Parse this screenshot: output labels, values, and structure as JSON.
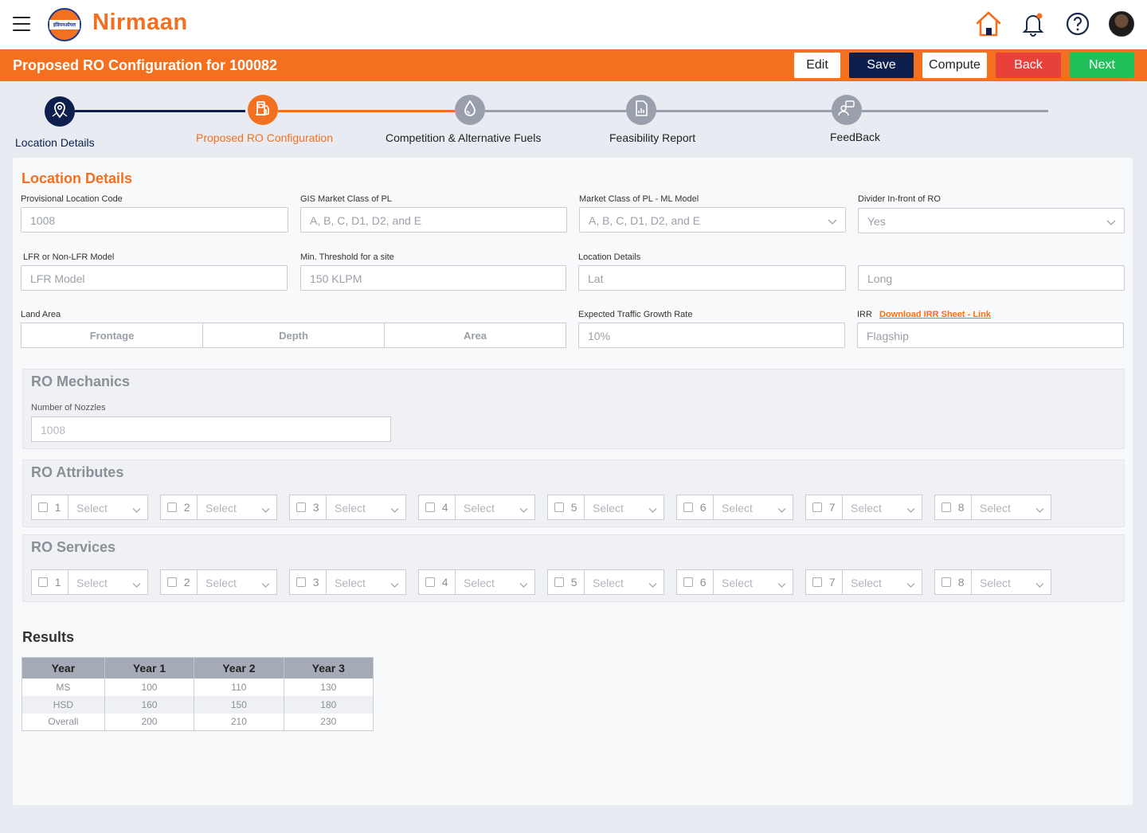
{
  "header": {
    "brand": "Nirmaan",
    "logo_text": "इंडियनऑयल",
    "icons": [
      "menu-icon",
      "home-icon",
      "bell-icon",
      "help-icon",
      "avatar"
    ]
  },
  "titlebar": {
    "title": "Proposed RO Configuration for 100082",
    "buttons": {
      "edit": "Edit",
      "save": "Save",
      "compute": "Compute",
      "back": "Back",
      "next": "Next"
    }
  },
  "stepper": {
    "steps": [
      {
        "label": "Location Details",
        "icon": "map-pin-icon",
        "state": "done"
      },
      {
        "label": "Proposed RO Configuration",
        "icon": "fuel-pump-icon",
        "state": "active"
      },
      {
        "label": "Competition & Alternative Fuels",
        "icon": "drop-icon",
        "state": "pending"
      },
      {
        "label": "Feasibility Report",
        "icon": "report-icon",
        "state": "pending"
      },
      {
        "label": "FeedBack",
        "icon": "feedback-icon",
        "state": "pending"
      }
    ]
  },
  "location": {
    "title": "Location Details",
    "provisional_code": {
      "label": "Provisional Location Code",
      "value": "1008"
    },
    "gis_market": {
      "label": "GIS Market Class of PL",
      "value": "A, B, C, D1, D2, and E"
    },
    "ml_market": {
      "label": "Market Class of PL - ML Model",
      "value": "A, B, C, D1, D2, and E"
    },
    "divider": {
      "label": "Divider In-front of RO",
      "value": "Yes"
    },
    "lfr_model": {
      "label": "LFR or Non-LFR Model",
      "value": "LFR Model"
    },
    "min_threshold": {
      "label": "Min. Threshold for a site",
      "value": "150 KLPM"
    },
    "location_details": {
      "label": "Location Details",
      "lat": "Lat",
      "long": "Long"
    },
    "land_area": {
      "label": "Land Area",
      "frontage": "Frontage",
      "depth": "Depth",
      "area": "Area"
    },
    "traffic_growth": {
      "label": "Expected Traffic Growth Rate",
      "value": "10%"
    },
    "irr": {
      "label": "IRR",
      "link": "Download IRR Sheet - Link",
      "value": "Flagship"
    }
  },
  "mechanics": {
    "title": "RO Mechanics",
    "nozzles": {
      "label": "Number of Nozzles",
      "value": "1008"
    }
  },
  "attributes": {
    "title": "RO Attributes",
    "items": [
      {
        "num": "1",
        "select": "Select"
      },
      {
        "num": "2",
        "select": "Select"
      },
      {
        "num": "3",
        "select": "Select"
      },
      {
        "num": "4",
        "select": "Select"
      },
      {
        "num": "5",
        "select": "Select"
      },
      {
        "num": "6",
        "select": "Select"
      },
      {
        "num": "7",
        "select": "Select"
      },
      {
        "num": "8",
        "select": "Select"
      }
    ]
  },
  "services": {
    "title": "RO Services",
    "items": [
      {
        "num": "1",
        "select": "Select"
      },
      {
        "num": "2",
        "select": "Select"
      },
      {
        "num": "3",
        "select": "Select"
      },
      {
        "num": "4",
        "select": "Select"
      },
      {
        "num": "5",
        "select": "Select"
      },
      {
        "num": "6",
        "select": "Select"
      },
      {
        "num": "7",
        "select": "Select"
      },
      {
        "num": "8",
        "select": "Select"
      }
    ]
  },
  "results": {
    "title": "Results",
    "headers": [
      "Year",
      "Year 1",
      "Year 2",
      "Year 3"
    ],
    "rows": [
      [
        "MS",
        "100",
        "110",
        "130"
      ],
      [
        "HSD",
        "160",
        "150",
        "180"
      ],
      [
        "Overall",
        "200",
        "210",
        "230"
      ]
    ]
  }
}
